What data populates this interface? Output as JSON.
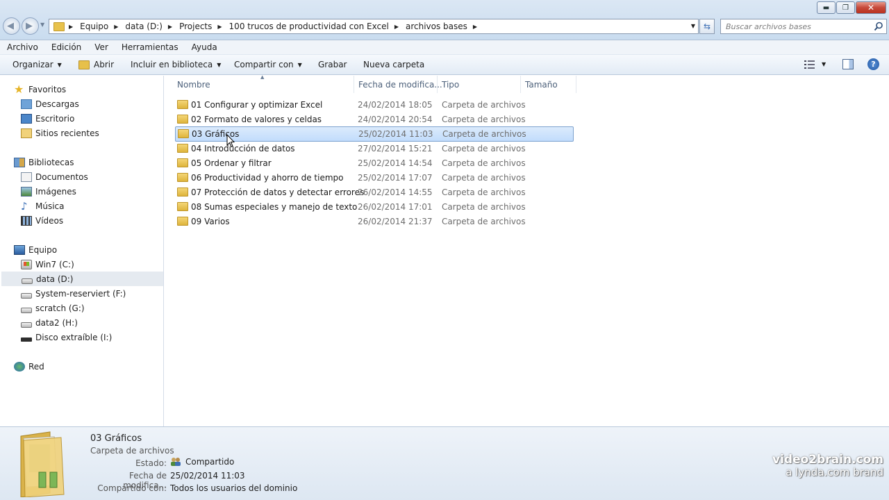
{
  "address": {
    "crumbs": [
      "Equipo",
      "data (D:)",
      "Projects",
      "100 trucos de productividad con Excel",
      "archivos bases"
    ]
  },
  "search": {
    "placeholder": "Buscar archivos bases"
  },
  "window_controls": {
    "minimize": "▬",
    "maximize": "❐",
    "close": "✕"
  },
  "menu": [
    "Archivo",
    "Edición",
    "Ver",
    "Herramientas",
    "Ayuda"
  ],
  "commands": {
    "organize": "Organizar",
    "open": "Abrir",
    "include": "Incluir en biblioteca",
    "share": "Compartir con",
    "burn": "Grabar",
    "new_folder": "Nueva carpeta",
    "help": "?"
  },
  "nav": {
    "favorites": "Favoritos",
    "downloads": "Descargas",
    "desktop": "Escritorio",
    "recent": "Sitios recientes",
    "libraries": "Bibliotecas",
    "documents": "Documentos",
    "images": "Imágenes",
    "music": "Música",
    "videos": "Vídeos",
    "computer": "Equipo",
    "drive_c": "Win7 (C:)",
    "drive_d": "data (D:)",
    "drive_f": "System-reserviert (F:)",
    "drive_g": "scratch (G:)",
    "drive_h": "data2 (H:)",
    "drive_i": "Disco extraíble (I:)",
    "network": "Red"
  },
  "columns": {
    "name": "Nombre",
    "date": "Fecha de modifica...",
    "type": "Tipo",
    "size": "Tamaño"
  },
  "files": [
    {
      "name": "01 Configurar y optimizar Excel",
      "date": "24/02/2014 18:05",
      "type": "Carpeta de archivos"
    },
    {
      "name": "02 Formato de valores y celdas",
      "date": "24/02/2014 20:54",
      "type": "Carpeta de archivos"
    },
    {
      "name": "03 Gráficos",
      "date": "25/02/2014 11:03",
      "type": "Carpeta de archivos"
    },
    {
      "name": "04 Introducción de datos",
      "date": "27/02/2014 15:21",
      "type": "Carpeta de archivos"
    },
    {
      "name": "05 Ordenar y filtrar",
      "date": "25/02/2014 14:54",
      "type": "Carpeta de archivos"
    },
    {
      "name": "06 Productividad y ahorro de tiempo",
      "date": "25/02/2014 17:07",
      "type": "Carpeta de archivos"
    },
    {
      "name": "07 Protección de datos y detectar errores",
      "date": "26/02/2014 14:55",
      "type": "Carpeta de archivos"
    },
    {
      "name": "08 Sumas especiales y manejo de texto",
      "date": "26/02/2014 17:01",
      "type": "Carpeta de archivos"
    },
    {
      "name": "09 Varios",
      "date": "26/02/2014 21:37",
      "type": "Carpeta de archivos"
    }
  ],
  "details": {
    "name": "03 Gráficos",
    "type": "Carpeta de archivos",
    "state_label": "Estado:",
    "state_value": "Compartido",
    "date_label": "Fecha de modifica...",
    "date_value": "25/02/2014 11:03",
    "shared_label": "Compartido con:",
    "shared_value": "Todos los usuarios del dominio"
  },
  "watermark": {
    "line1": "video2brain.com",
    "line2": "a lynda.com brand"
  },
  "colors": {
    "selection": "#c1dcfc",
    "selection_border": "#7da2ce",
    "folder": "#e9c351",
    "chrome": "#dbe7f4"
  }
}
